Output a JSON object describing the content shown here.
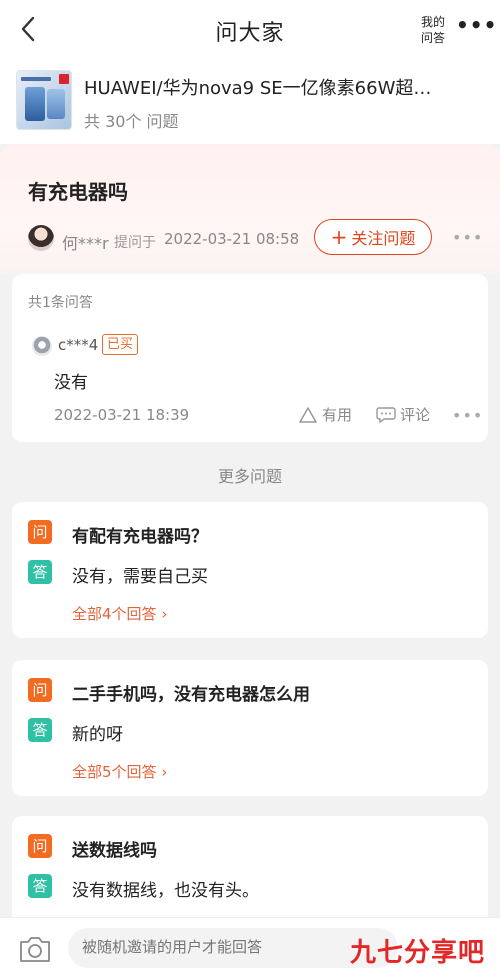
{
  "header": {
    "title": "问大家",
    "my_answers_line1": "我的",
    "my_answers_line2": "问答",
    "more_label": "•••"
  },
  "product": {
    "name": "HUAWEI/华为nova9 SE一亿像素66W超…",
    "question_count": "共 30个 问题"
  },
  "question": {
    "title": "有充电器吗",
    "asker": "何***r",
    "asked_label": "提问于",
    "asked_time": "2022-03-21 08:58",
    "follow_label": "关注问题",
    "more_label": "•••"
  },
  "answers": {
    "count_label": "共1条问答",
    "items": [
      {
        "user": "c***4",
        "badge": "已买",
        "text": "没有",
        "time": "2022-03-21 18:39",
        "useful_label": "有用",
        "comment_label": "评论"
      }
    ]
  },
  "more_questions": {
    "title": "更多问题",
    "q_tag": "问",
    "a_tag": "答",
    "items": [
      {
        "question": "有配有充电器吗？",
        "answer": "没有，需要自己买",
        "all_answers": "全部4个回答"
      },
      {
        "question": "二手手机吗，没有充电器怎么用",
        "answer": "新的呀",
        "all_answers": "全部5个回答"
      },
      {
        "question": "送数据线吗",
        "answer": "没有数据线，也没有头。"
      }
    ]
  },
  "bottom": {
    "placeholder": "被随机邀请的用户才能回答",
    "watermark": "九七分享吧"
  },
  "colors": {
    "accent": "#e2431a",
    "question_tag": "#f36b21",
    "answer_tag": "#2fc0a6",
    "link": "#e6623a"
  }
}
